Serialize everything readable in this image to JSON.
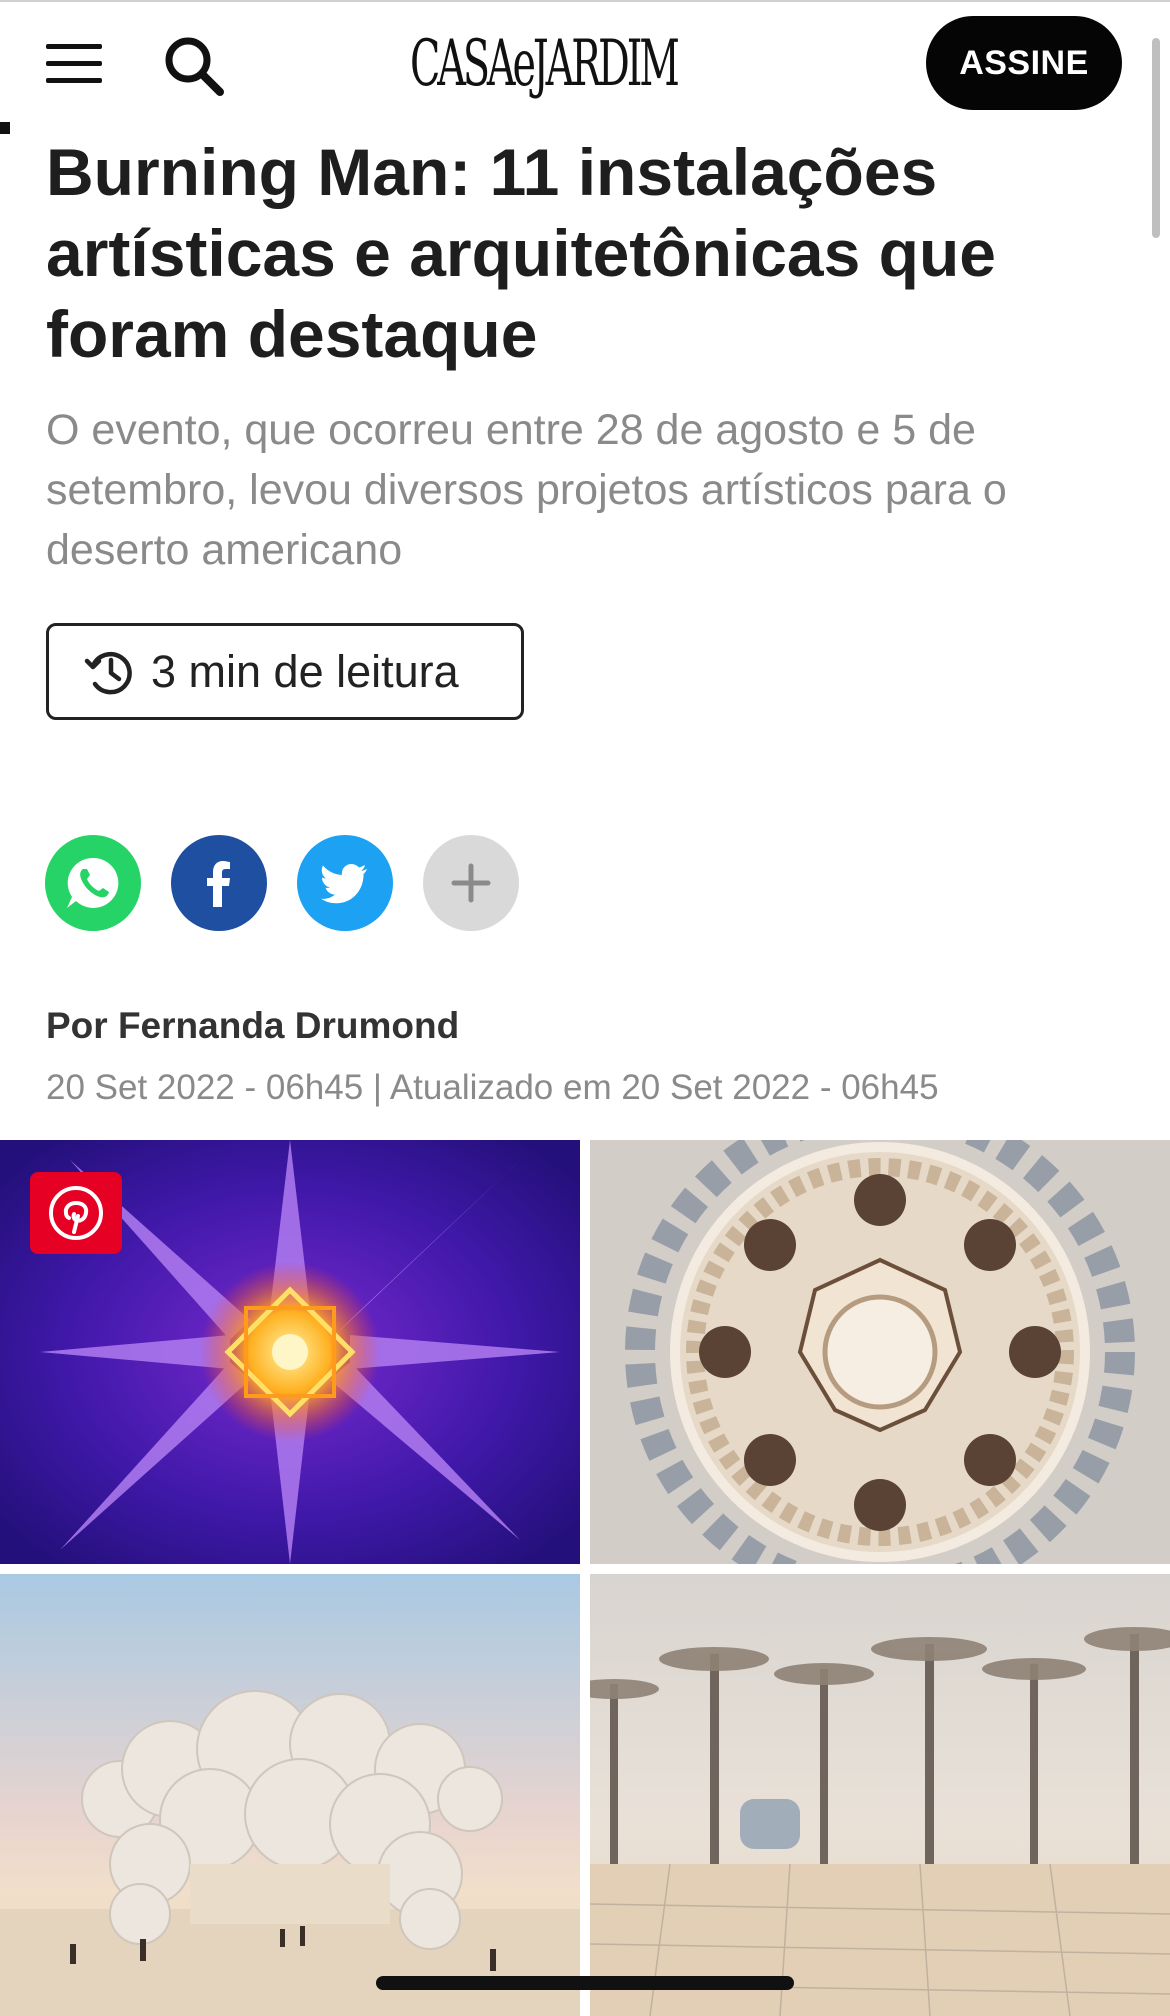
{
  "header": {
    "logo_text": "CASAeJARDIM",
    "subscribe_label": "ASSINE",
    "menu_icon": "hamburger-menu-icon",
    "search_icon": "search-icon"
  },
  "article": {
    "title": "Burning Man: 11 instalações artísticas e arquitetônicas que foram destaque",
    "subtitle": "O evento, que ocorreu entre 28 de agosto e 5 de setembro, levou diversos projetos artísticos para o deserto americano",
    "reading_time": "3 min de leitura",
    "author": "Por Fernanda Drumond",
    "dateline": "20 Set 2022 - 06h45 | Atualizado em 20 Set 2022 - 06h45"
  },
  "share": {
    "buttons": [
      "whatsapp-icon",
      "facebook-icon",
      "twitter-icon",
      "plus-icon"
    ],
    "colors": {
      "whatsapp": "#25d366",
      "facebook": "#1f4fa0",
      "twitter": "#1da1f2",
      "more": "#d9d9d9"
    }
  },
  "gallery": {
    "images": [
      "neon-star-installation-image",
      "geometric-mandala-structure-image",
      "white-inflatable-spheres-sculpture-image",
      "wooden-tree-structures-image"
    ],
    "pin_icon": "pinterest-icon"
  }
}
